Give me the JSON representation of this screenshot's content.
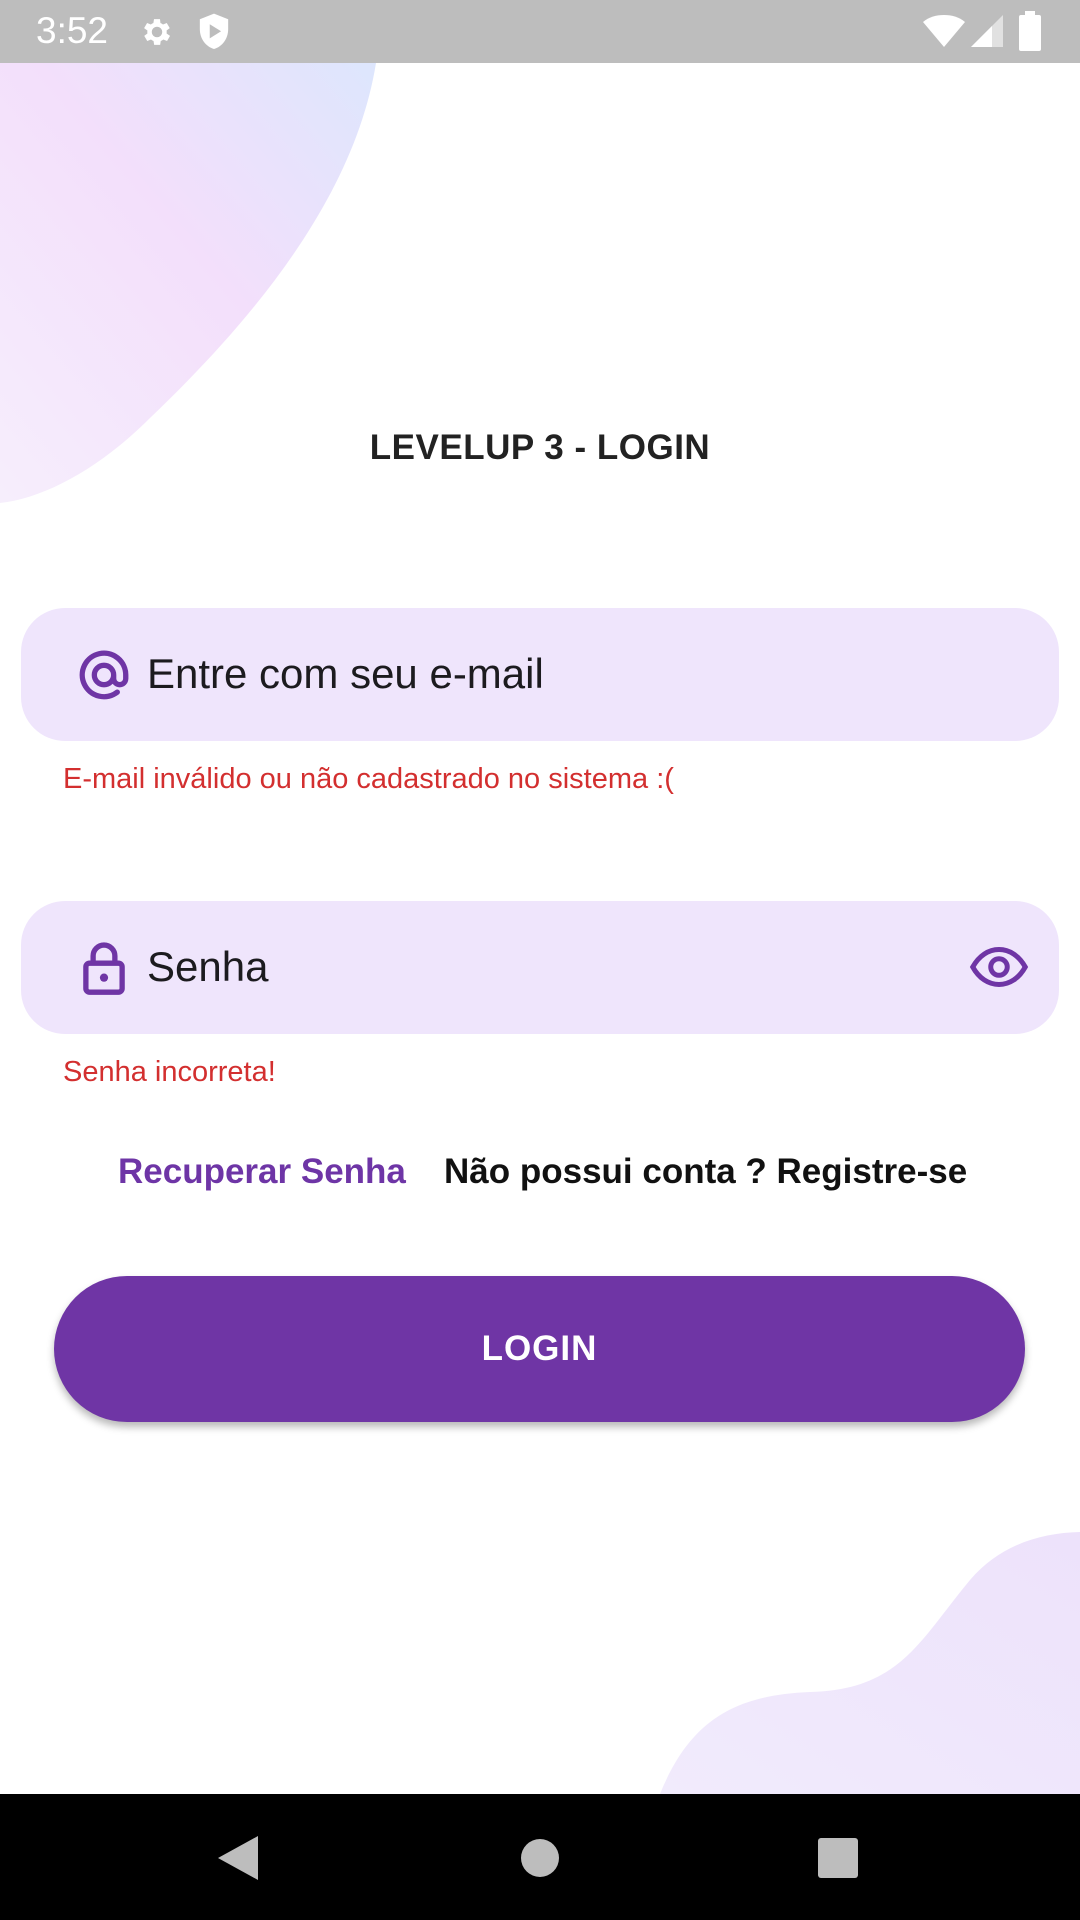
{
  "status_bar": {
    "time": "3:52",
    "icons": [
      "gear-icon",
      "shield-play-icon",
      "wifi-icon",
      "signal-icon",
      "battery-icon"
    ]
  },
  "page": {
    "title": "LEVELUP 3 - LOGIN"
  },
  "email": {
    "placeholder": "Entre com seu e-mail",
    "icon": "at-sign-icon",
    "error": "E-mail inválido ou não cadastrado no sistema :("
  },
  "password": {
    "placeholder": "Senha",
    "icon": "lock-icon",
    "toggle_icon": "eye-icon",
    "error": "Senha incorreta!"
  },
  "links": {
    "recover": "Recuperar Senha",
    "register": "Não possui conta ? Registre-se"
  },
  "login_button": {
    "label": "LOGIN"
  },
  "nav_bar": {
    "icons": [
      "back-icon",
      "home-icon",
      "recents-icon"
    ]
  },
  "colors": {
    "primary": "#6f35a5",
    "field_background": "#efe5fc",
    "error": "#d32f2f",
    "status_bar": "#bdbdbd"
  }
}
